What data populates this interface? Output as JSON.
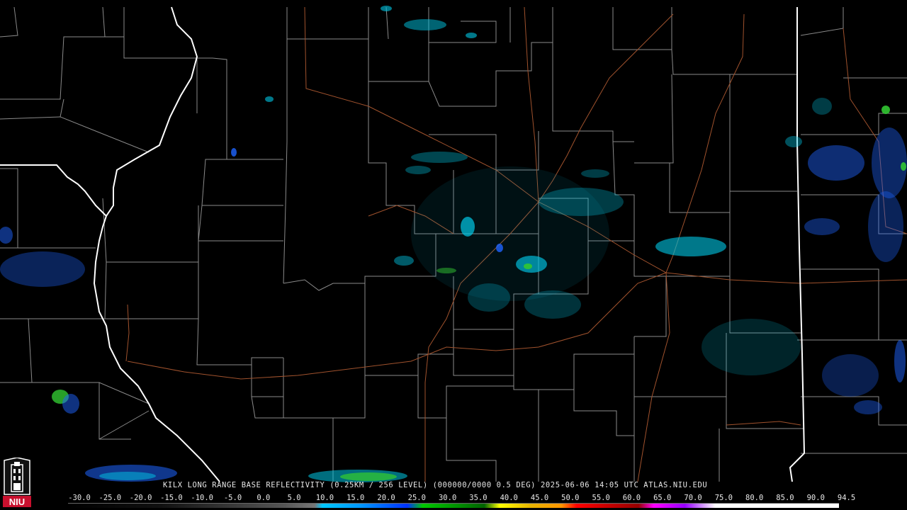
{
  "product_caption": "KILX LONG RANGE BASE REFLECTIVITY (0.25KM / 256 LEVEL) (000000/0000 0.5 DEG) 2025-06-06 14:05 UTC  ATLAS.NIU.EDU",
  "colorbar": {
    "labels": [
      "-30.0",
      "-25.0",
      "-20.0",
      "-15.0",
      "-10.0",
      "-5.0",
      "0.0",
      "5.0",
      "10.0",
      "15.0",
      "20.0",
      "25.0",
      "30.0",
      "35.0",
      "40.0",
      "45.0",
      "50.0",
      "55.0",
      "60.0",
      "65.0",
      "70.0",
      "75.0",
      "80.0",
      "85.0",
      "90.0",
      "94.5"
    ]
  },
  "logo": {
    "text": "NIU",
    "icon": "niu-tower-logo-icon",
    "color": "#c8102e"
  },
  "colors": {
    "background": "#000000",
    "county_lines": "#8a8a8a",
    "state_lines": "#ffffff",
    "highways": "#a0522d",
    "echo_light": "#00c8e6",
    "echo_medium": "#1e64ff",
    "echo_strong": "#32c832"
  }
}
